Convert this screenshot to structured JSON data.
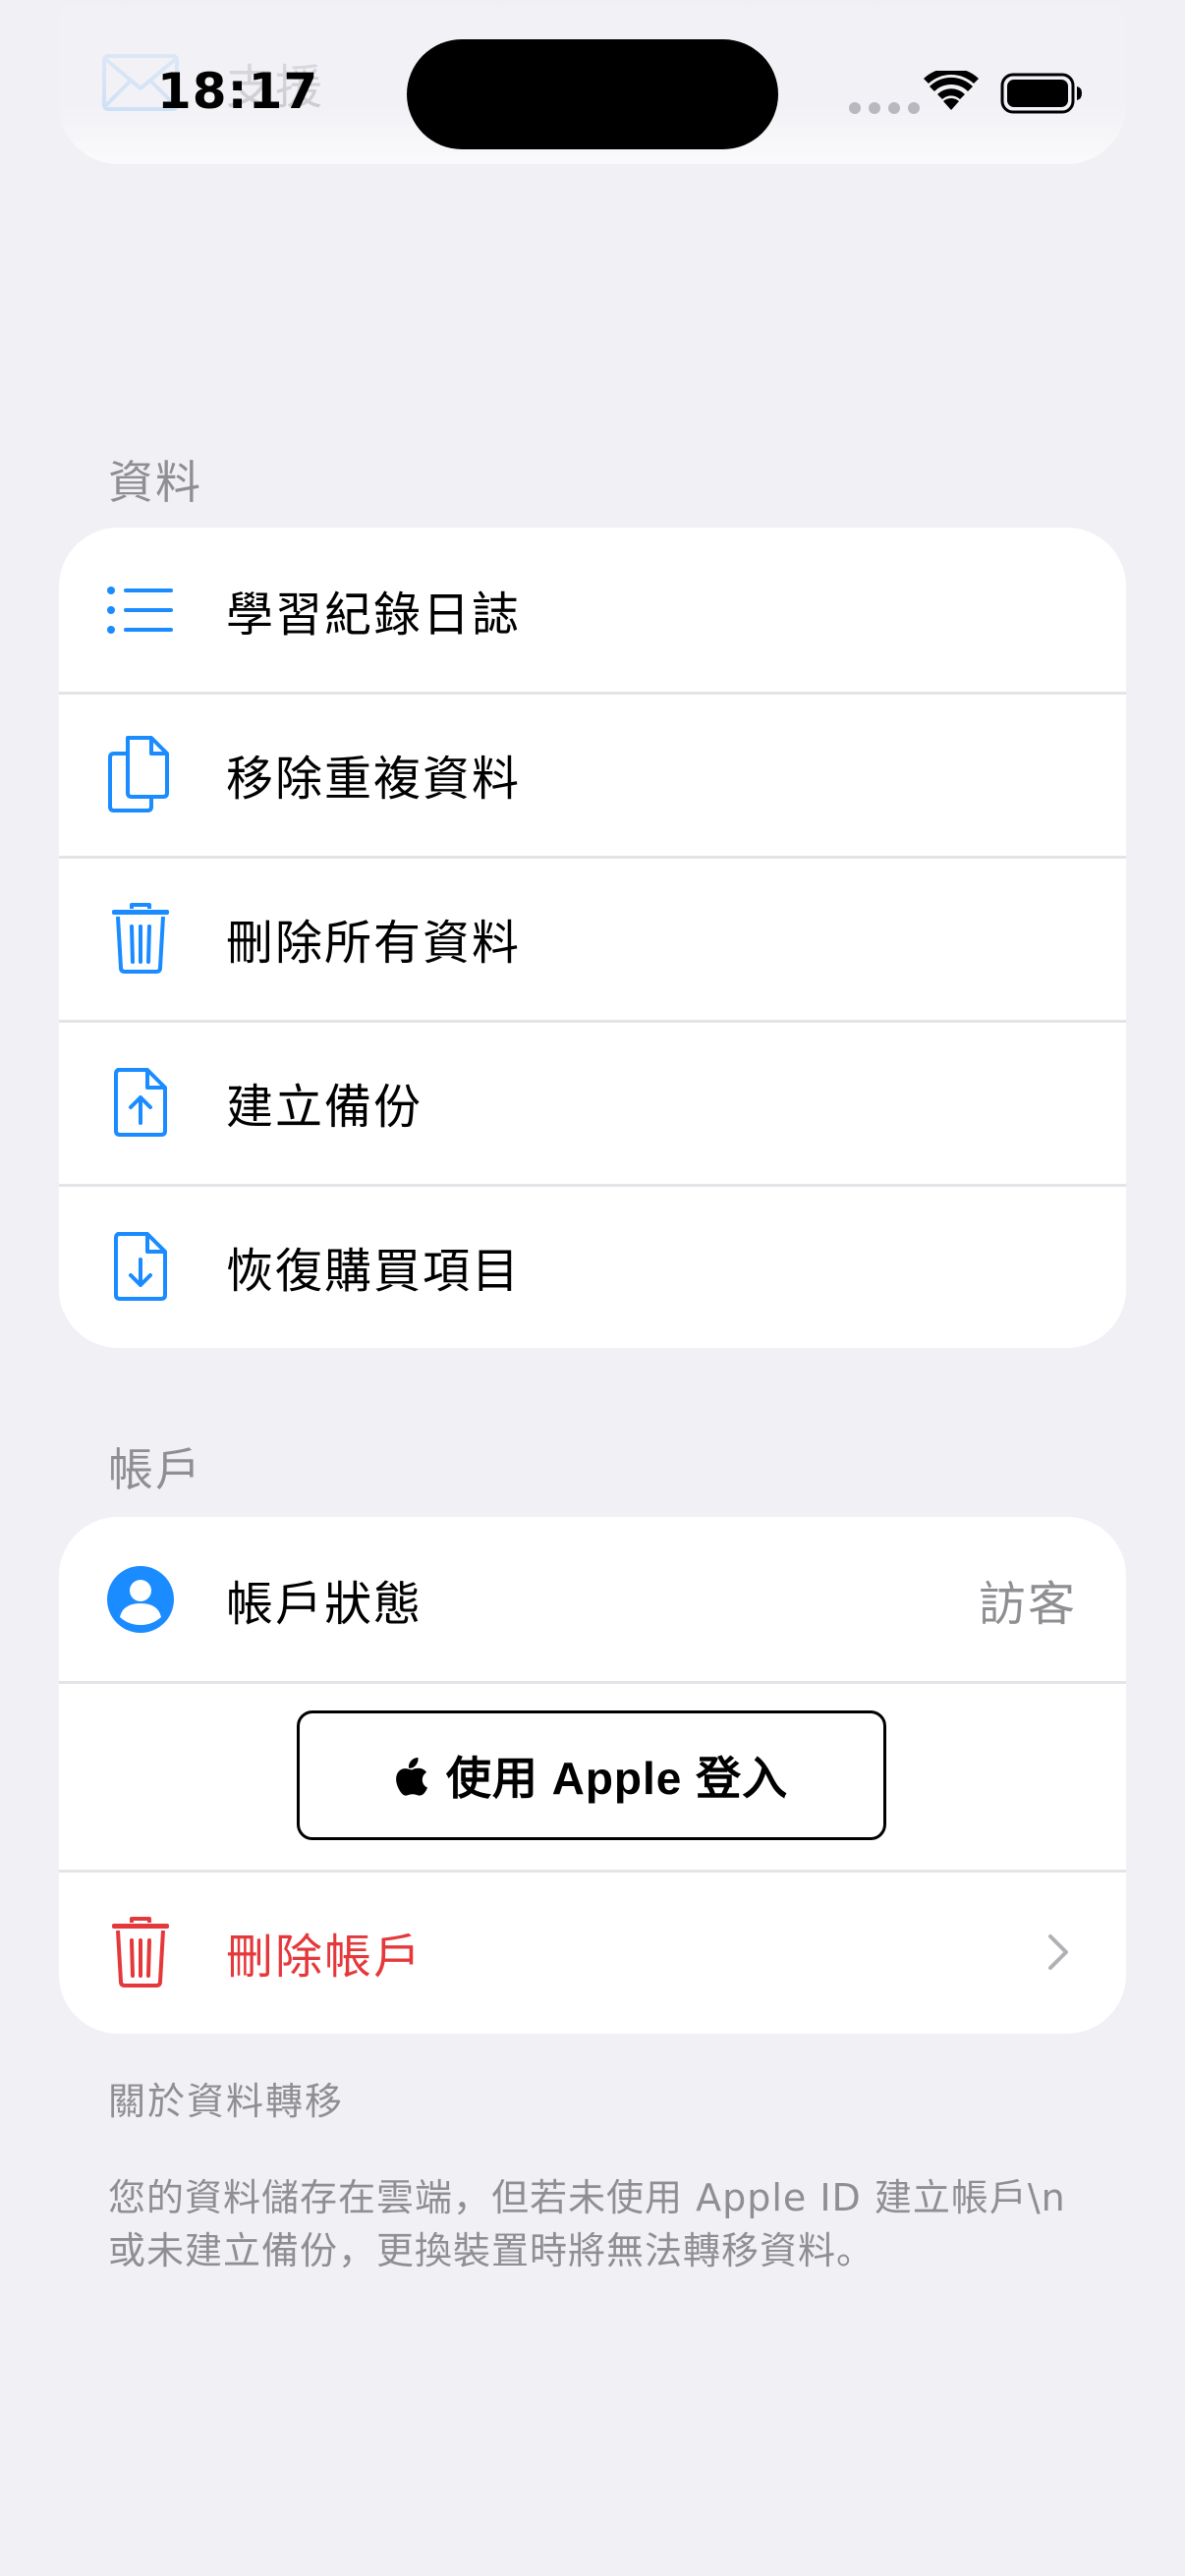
{
  "status_bar": {
    "time": "18:17"
  },
  "top_card": {
    "review_label": "評論",
    "support_label": "支援"
  },
  "data_section": {
    "header": "資料",
    "items": [
      {
        "label": "學習紀錄日誌",
        "icon": "list-icon"
      },
      {
        "label": "移除重複資料",
        "icon": "duplicate-docs-icon"
      },
      {
        "label": "刪除所有資料",
        "icon": "trash-icon"
      },
      {
        "label": "建立備份",
        "icon": "doc-upload-icon"
      },
      {
        "label": "恢復購買項目",
        "icon": "doc-download-icon"
      }
    ]
  },
  "account_section": {
    "header": "帳戶",
    "status_label": "帳戶狀態",
    "status_value": "訪客",
    "sign_in_label": "使用 Apple 登入",
    "delete_label": "刪除帳戶"
  },
  "transfer_note": {
    "title": "關於資料轉移",
    "body": "您的資料儲存在雲端，但若未使用 Apple ID 建立帳戶\\n 或未建立備份，更換裝置時將無法轉移資料。"
  },
  "colors": {
    "accent": "#1A8CFF",
    "danger": "#E5383B",
    "background": "#F0F0F5",
    "secondary_text": "#8E8E93"
  }
}
